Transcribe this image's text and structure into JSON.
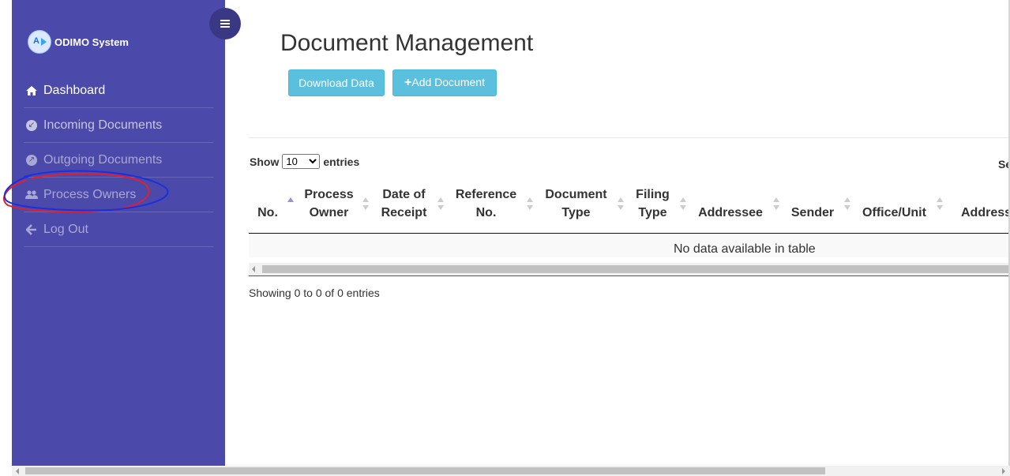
{
  "app": {
    "name": "ODIMO System"
  },
  "sidebar": {
    "items": [
      {
        "label": "Dashboard",
        "icon": "home-icon"
      },
      {
        "label": "Incoming Documents",
        "icon": "arrow-down-left-circle-icon"
      },
      {
        "label": "Outgoing Documents",
        "icon": "arrow-up-right-circle-icon"
      },
      {
        "label": "Process Owners",
        "icon": "users-icon"
      },
      {
        "label": "Log Out",
        "icon": "arrow-left-icon"
      }
    ]
  },
  "page": {
    "title": "Document Management"
  },
  "toolbar": {
    "download_label": "Download Data",
    "add_label": "Add Document",
    "add_icon": "+"
  },
  "table": {
    "length_prefix": "Show",
    "length_value": "10",
    "length_options": [
      "10"
    ],
    "length_suffix": "entries",
    "search_label": "Search:",
    "columns": [
      "No.",
      "Process Owner",
      "Date of Receipt",
      "Reference No.",
      "Document Type",
      "Filing Type",
      "Addressee",
      "Sender",
      "Office/Unit",
      "Addressee"
    ],
    "empty_message": "No data available in table",
    "info": "Showing 0 to 0 of 0 entries"
  },
  "colors": {
    "sidebar_bg": "#4b49a9",
    "toggle_bg": "#3a3885",
    "button_bg": "#5bc0de",
    "annotation_red": "#e0202a",
    "annotation_blue": "#1a2fe0"
  }
}
